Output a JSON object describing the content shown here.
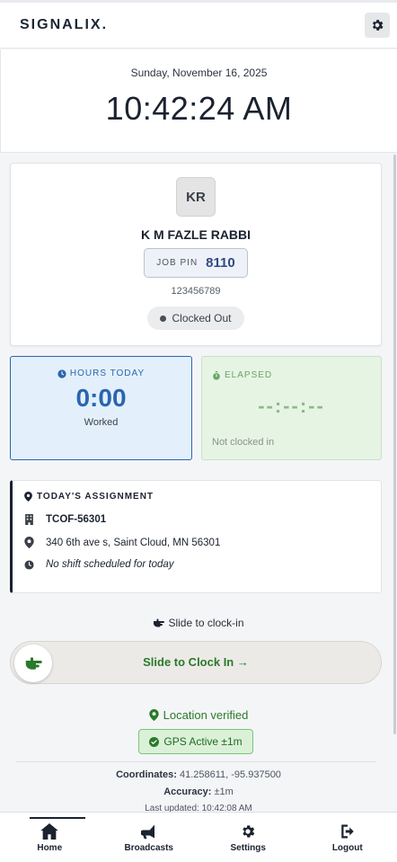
{
  "app": {
    "brand": "SIGNALIX."
  },
  "clock": {
    "date": "Sunday, November 16, 2025",
    "time": "10:42:24 AM"
  },
  "profile": {
    "initials": "KR",
    "name": "K M FAZLE RABBI",
    "pin_label": "JOB PIN",
    "pin_value": "8110",
    "employee_id": "123456789",
    "status": "Clocked Out"
  },
  "hours_today": {
    "label": "HOURS TODAY",
    "value": "0:00",
    "sub": "Worked"
  },
  "elapsed": {
    "label": "ELAPSED",
    "value": "--:--:--",
    "sub": "Not clocked in"
  },
  "assignment": {
    "title": "TODAY'S ASSIGNMENT",
    "job_code": "TCOF-56301",
    "address": "340 6th ave s, Saint Cloud, MN 56301",
    "schedule": "No shift scheduled for today"
  },
  "clock_in": {
    "hint": "Slide to clock-in",
    "slider_label": "Slide to Clock In →"
  },
  "location": {
    "verified_text": "Location verified",
    "gps_badge": "GPS Active ±1m",
    "coordinates_label": "Coordinates:",
    "coordinates_value": "41.258611, -95.937500",
    "accuracy_label": "Accuracy:",
    "accuracy_value": "±1m",
    "last_updated_label": "Last updated:",
    "last_updated_value": "10:42:08 AM"
  },
  "nav": {
    "items": [
      {
        "label": "Home",
        "icon": "home-icon",
        "active": true
      },
      {
        "label": "Broadcasts",
        "icon": "megaphone-icon",
        "active": false
      },
      {
        "label": "Settings",
        "icon": "gear-icon",
        "active": false
      },
      {
        "label": "Logout",
        "icon": "logout-icon",
        "active": false
      }
    ]
  },
  "colors": {
    "primary_blue": "#2a65b0",
    "success_green": "#2a7a2a",
    "dark": "#1b2230"
  }
}
